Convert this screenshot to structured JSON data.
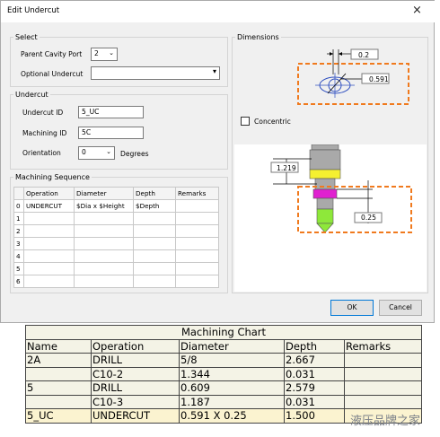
{
  "dialog": {
    "title": "Edit Undercut",
    "close_glyph": "×",
    "select_group": {
      "legend": "Select",
      "parent_cavity_label": "Parent Cavity Port",
      "parent_cavity_value": "2",
      "optional_undercut_label": "Optional Undercut",
      "optional_undercut_value": ""
    },
    "undercut_group": {
      "legend": "Undercut",
      "id_label": "Undercut ID",
      "id_value": "5_UC",
      "machining_label": "Machining ID",
      "machining_value": "5C",
      "orientation_label": "Orientation",
      "orientation_value": "0",
      "degrees_label": "Degrees"
    },
    "sequence_group": {
      "legend": "Machining Sequence",
      "columns": [
        "Operation",
        "Diameter",
        "Depth",
        "Remarks"
      ],
      "rows": [
        {
          "index": "0",
          "operation": "UNDERCUT",
          "diameter": "$Dia x $Height",
          "depth": "$Depth",
          "remarks": ""
        },
        {
          "index": "1",
          "operation": "",
          "diameter": "",
          "depth": "",
          "remarks": ""
        },
        {
          "index": "2",
          "operation": "",
          "diameter": "",
          "depth": "",
          "remarks": ""
        },
        {
          "index": "3",
          "operation": "",
          "diameter": "",
          "depth": "",
          "remarks": ""
        },
        {
          "index": "4",
          "operation": "",
          "diameter": "",
          "depth": "",
          "remarks": ""
        },
        {
          "index": "5",
          "operation": "",
          "diameter": "",
          "depth": "",
          "remarks": ""
        },
        {
          "index": "6",
          "operation": "",
          "diameter": "",
          "depth": "",
          "remarks": ""
        }
      ]
    },
    "dimensions_group": {
      "legend": "Dimensions",
      "top_dim_value": "0.2",
      "dia_value": "0.591",
      "concentric_label": "Concentric",
      "depth_total_value": "1.219",
      "height_value": "0.25"
    },
    "ok_label": "OK",
    "cancel_label": "Cancel"
  },
  "machining_chart": {
    "title": "Machining Chart",
    "columns": [
      "Name",
      "Operation",
      "Diameter",
      "Depth",
      "Remarks"
    ],
    "rows": [
      [
        "2A",
        "DRILL",
        "5/8",
        "2.667",
        ""
      ],
      [
        "",
        "C10-2",
        "1.344",
        "0.031",
        ""
      ],
      [
        "5",
        "DRILL",
        "0.609",
        "2.579",
        ""
      ],
      [
        "",
        "C10-3",
        "1.187",
        "0.031",
        ""
      ],
      [
        "5_UC",
        "UNDERCUT",
        "0.591 X 0.25",
        "1.500",
        ""
      ]
    ]
  },
  "watermark": "液压品牌之家",
  "colors": {
    "accent_dashed": "#f07a1e",
    "magenta": "#e020d0",
    "yellow": "#f5f030",
    "green": "#8ee83a",
    "gray_part": "#a9a9a9"
  }
}
